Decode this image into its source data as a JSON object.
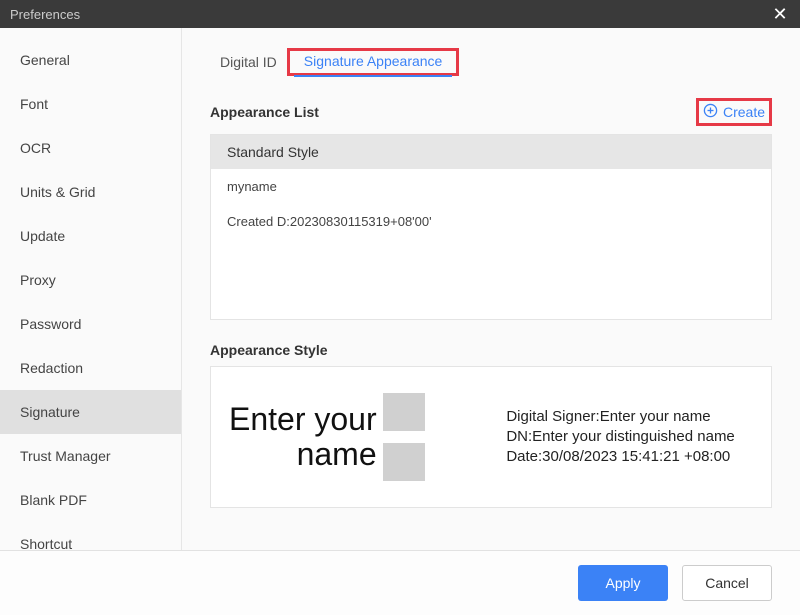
{
  "window": {
    "title": "Preferences"
  },
  "sidebar": {
    "items": [
      {
        "label": "General"
      },
      {
        "label": "Font"
      },
      {
        "label": "OCR"
      },
      {
        "label": "Units & Grid"
      },
      {
        "label": "Update"
      },
      {
        "label": "Proxy"
      },
      {
        "label": "Password"
      },
      {
        "label": "Redaction"
      },
      {
        "label": "Signature"
      },
      {
        "label": "Trust Manager"
      },
      {
        "label": "Blank PDF"
      },
      {
        "label": "Shortcut"
      }
    ],
    "selected_index": 8
  },
  "tabs": {
    "items": [
      {
        "label": "Digital ID"
      },
      {
        "label": "Signature Appearance"
      }
    ],
    "active_index": 1
  },
  "appearance_list": {
    "title": "Appearance List",
    "create_label": "Create",
    "header": "Standard Style",
    "rows": [
      "myname",
      "Created D:20230830115319+08'00'"
    ]
  },
  "appearance_style": {
    "title": "Appearance Style",
    "big_text_line1": "Enter your",
    "big_text_line2": "name",
    "detail_signer": "Digital Signer:Enter your name",
    "detail_dn": "DN:Enter your distinguished name",
    "detail_date": "Date:30/08/2023 15:41:21 +08:00"
  },
  "footer": {
    "apply": "Apply",
    "cancel": "Cancel"
  },
  "colors": {
    "accent": "#3b82f6",
    "highlight_border": "#e63946"
  }
}
